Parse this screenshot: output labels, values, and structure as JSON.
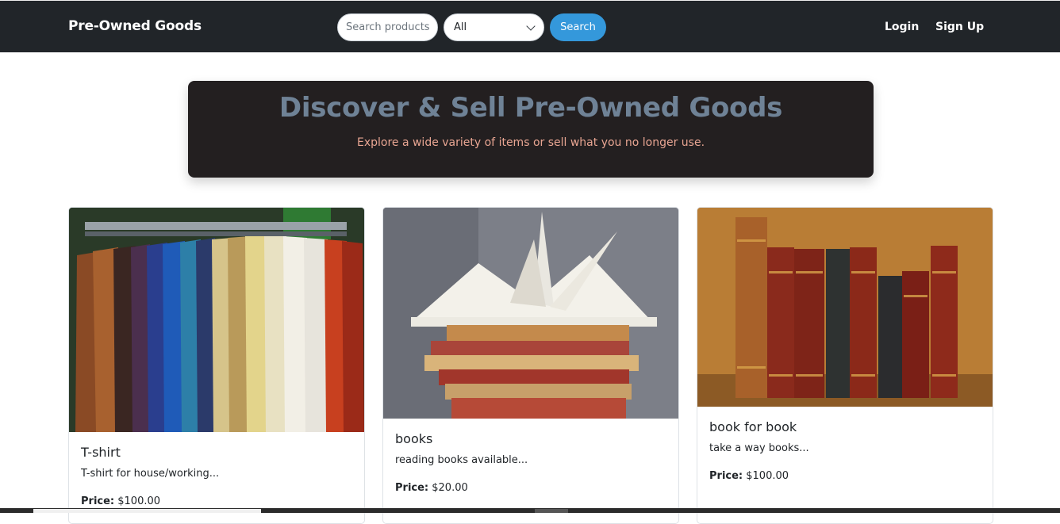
{
  "navbar": {
    "brand": "Pre-Owned Goods",
    "search_placeholder": "Search products",
    "category_selected": "All",
    "search_button": "Search",
    "login": "Login",
    "signup": "Sign Up"
  },
  "hero": {
    "title": "Discover & Sell Pre-Owned Goods",
    "subtitle": "Explore a wide variety of items or sell what you no longer use."
  },
  "products": [
    {
      "title": "T-shirt",
      "description": "T-shirt for house/working...",
      "price_label": "Price:",
      "price": "$100.00",
      "image": "clothes-rack"
    },
    {
      "title": "books",
      "description": "reading books available...",
      "price_label": "Price:",
      "price": "$20.00",
      "image": "book-stack"
    },
    {
      "title": "book for book",
      "description": "take a way books...",
      "price_label": "Price:",
      "price": "$100.00",
      "image": "antique-books"
    }
  ],
  "colors": {
    "navbar_bg": "#212529",
    "accent": "#3498db",
    "hero_bg": "#231f20",
    "hero_title": "#6f8296",
    "hero_subtitle": "#e8a592"
  }
}
